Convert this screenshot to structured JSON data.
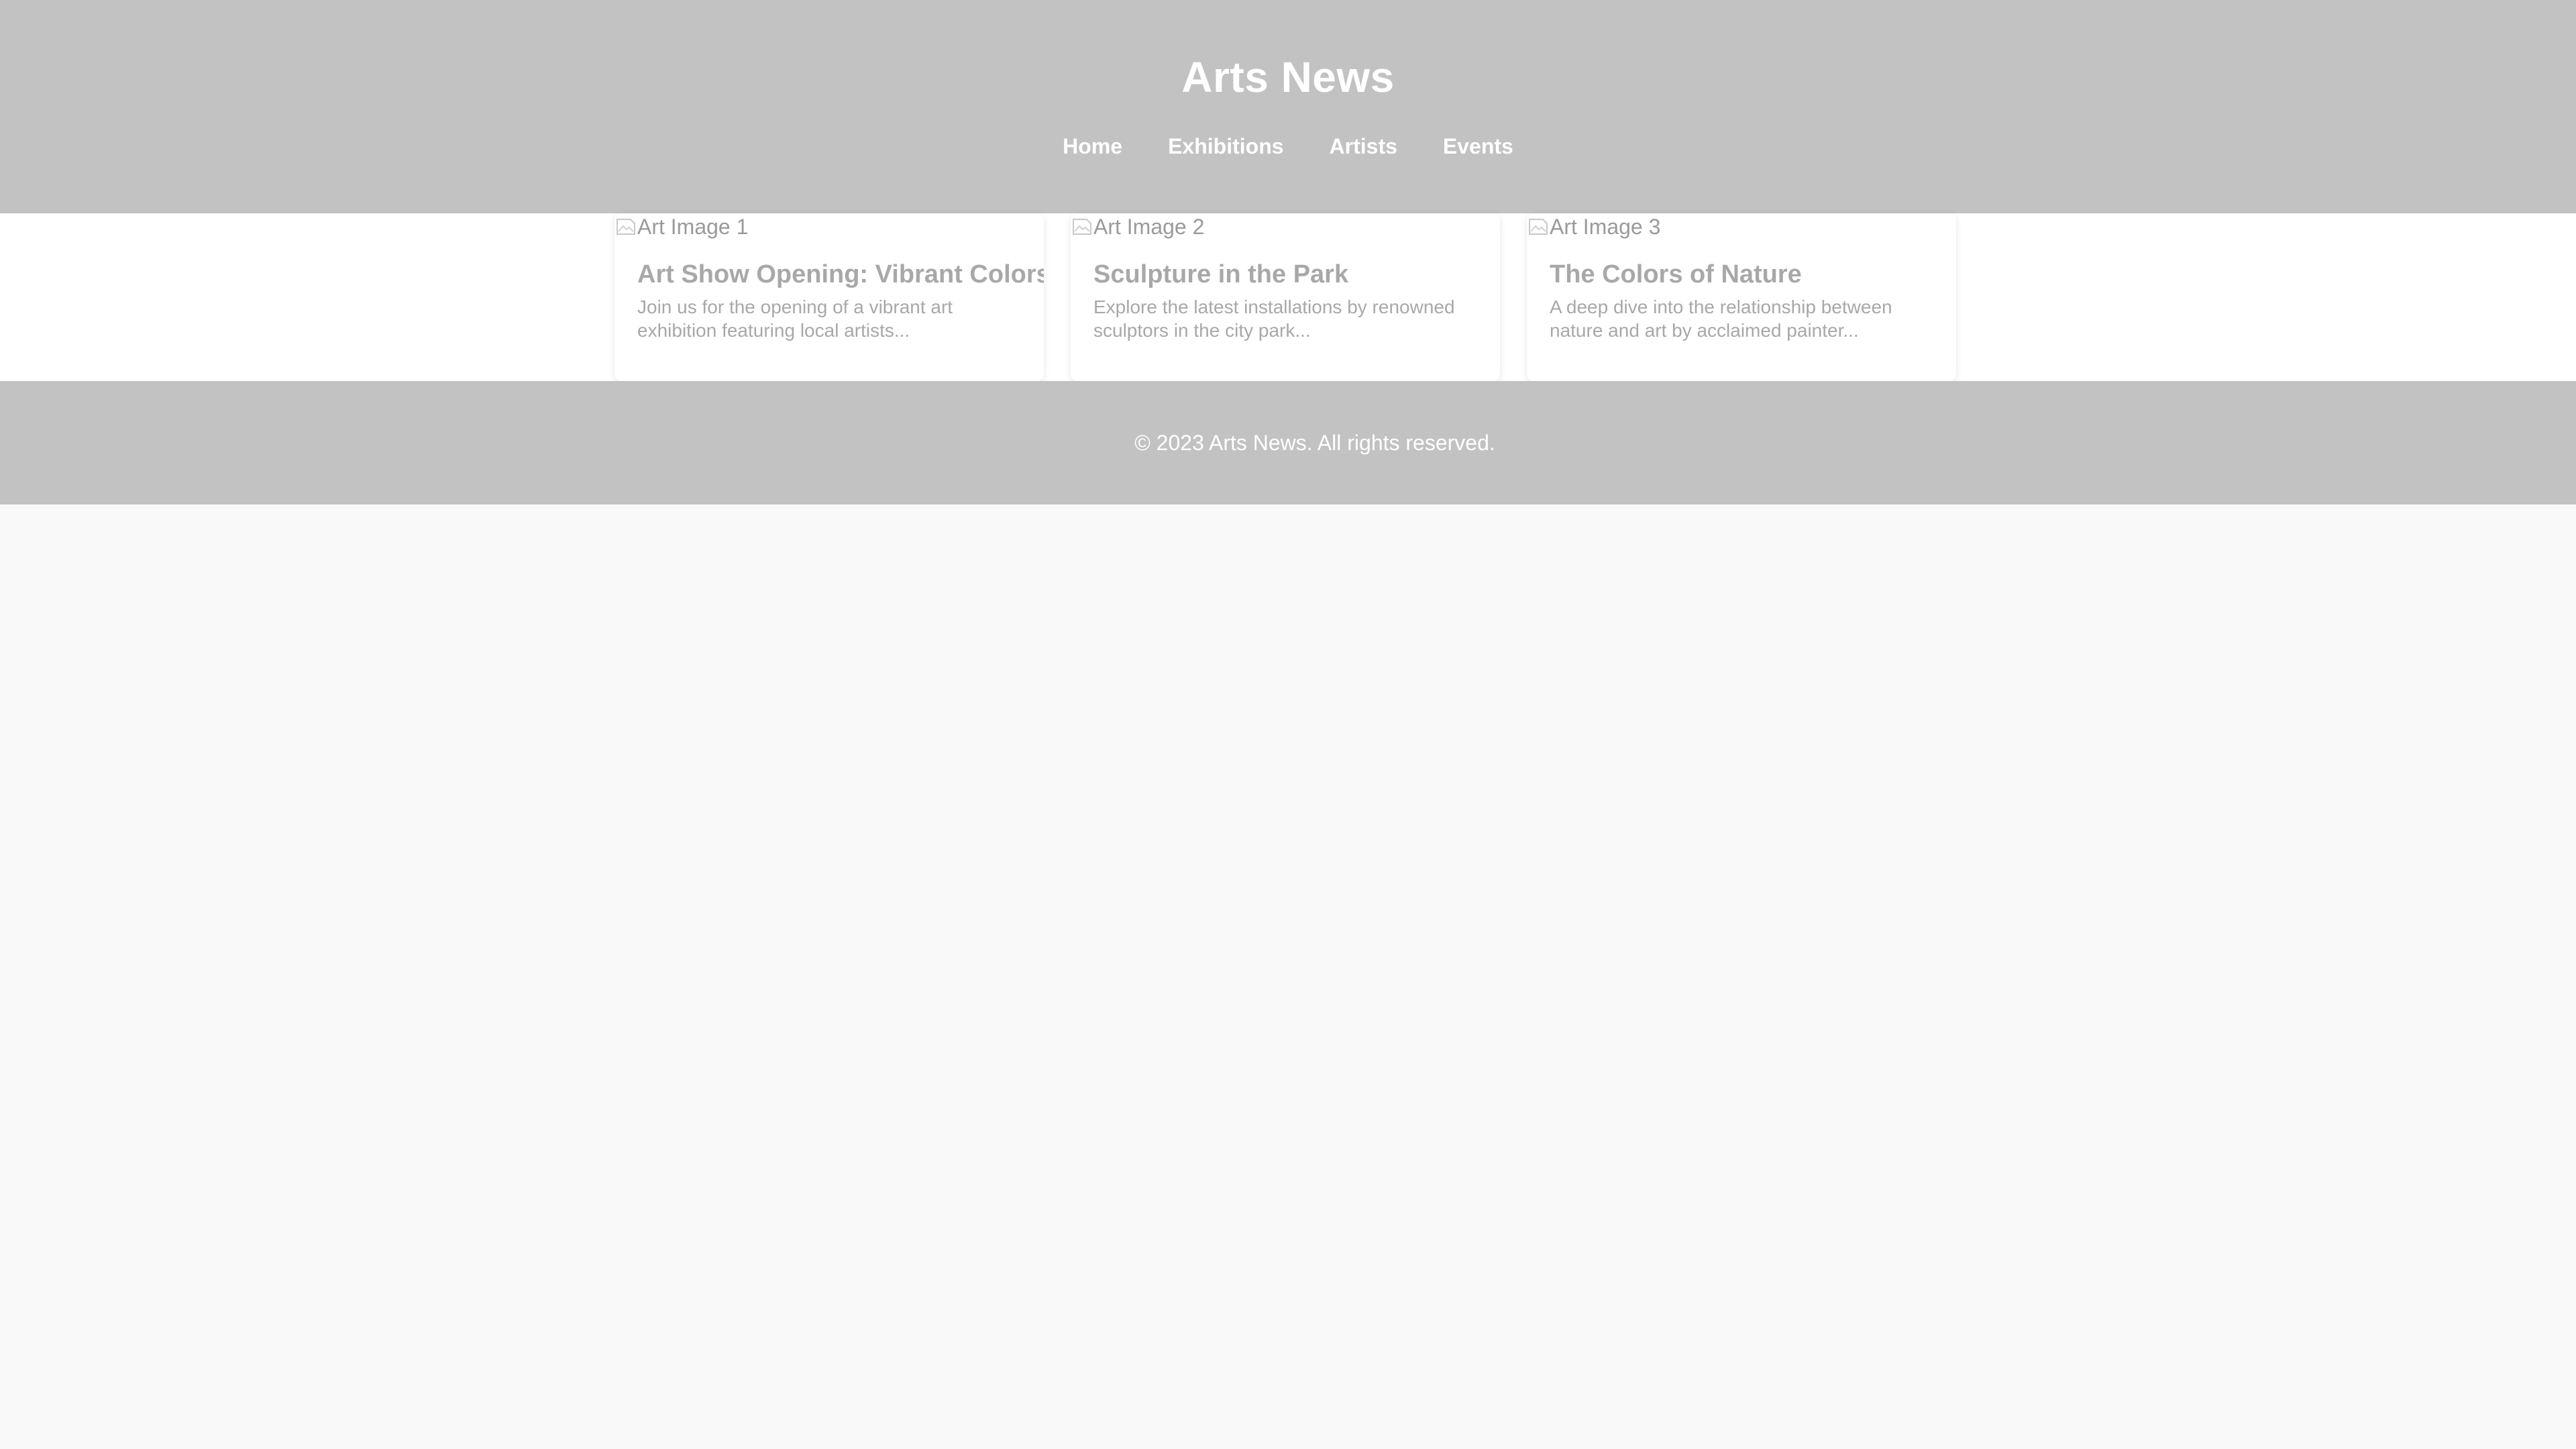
{
  "site": {
    "title": "Arts News",
    "nav": [
      "Home",
      "Exhibitions",
      "Artists",
      "Events"
    ]
  },
  "articles": [
    {
      "image_alt": "Art Image 1",
      "title": "Art Show Opening: Vibrant Colors",
      "excerpt": "Join us for the opening of a vibrant art exhibition featuring local artists..."
    },
    {
      "image_alt": "Art Image 2",
      "title": "Sculpture in the Park",
      "excerpt": "Explore the latest installations by renowned sculptors in the city park..."
    },
    {
      "image_alt": "Art Image 3",
      "title": "The Colors of Nature",
      "excerpt": "A deep dive into the relationship between nature and art by acclaimed painter..."
    }
  ],
  "footer": {
    "text": "© 2023 Arts News. All rights reserved."
  },
  "colors": {
    "header_bg": "#c2c2c2",
    "footer_bg": "#c2c2c2",
    "page_bg": "#f9f9f9",
    "card_bg": "#ffffff",
    "muted_text": "#a8a8a8"
  }
}
